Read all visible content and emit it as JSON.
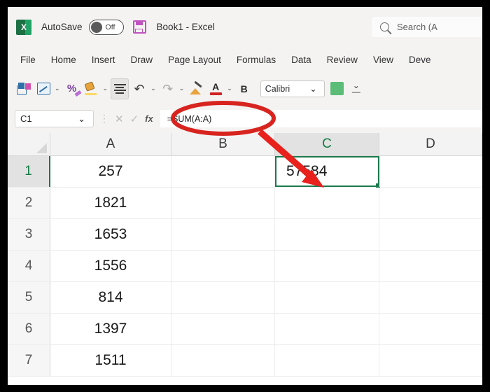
{
  "titlebar": {
    "app_icon": "excel-logo-icon",
    "autosave_label": "AutoSave",
    "autosave_state": "Off",
    "save_icon": "save-disk-icon",
    "document_title": "Book1  -  Excel",
    "search_icon": "search-icon",
    "search_placeholder": "Search (A"
  },
  "ribbon": {
    "tabs": [
      {
        "label": "File"
      },
      {
        "label": "Home"
      },
      {
        "label": "Insert"
      },
      {
        "label": "Draw"
      },
      {
        "label": "Page Layout"
      },
      {
        "label": "Formulas"
      },
      {
        "label": "Data"
      },
      {
        "label": "Review"
      },
      {
        "label": "View"
      },
      {
        "label": "Deve"
      }
    ]
  },
  "toolbar": {
    "items": [
      {
        "icon": "paste-icon"
      },
      {
        "icon": "edit-cell-icon"
      },
      {
        "icon": "percent-style-icon"
      },
      {
        "icon": "fill-color-icon"
      },
      {
        "icon": "align-text-icon"
      },
      {
        "icon": "undo-icon"
      },
      {
        "icon": "redo-icon"
      },
      {
        "icon": "format-painter-icon"
      },
      {
        "icon": "font-color-icon"
      },
      {
        "icon": "bold-icon"
      }
    ],
    "bold_label": "B",
    "font_name": "Calibri",
    "caret": "⌄",
    "fill_swatch_color": "#5bbd77",
    "overflow_glyph": "⌄"
  },
  "formula_bar": {
    "name_box_value": "C1",
    "name_box_caret": "⌄",
    "separator": "⋮",
    "cancel_icon": "cancel-x-icon",
    "cancel_glyph": "✕",
    "confirm_icon": "confirm-check-icon",
    "confirm_glyph": "✓",
    "function_label": "fx",
    "formula_value": "=SUM(A:A)"
  },
  "grid": {
    "select_all_icon": "select-all-corner-icon",
    "columns": [
      {
        "label": "A",
        "width": 173,
        "active": false
      },
      {
        "label": "B",
        "width": 148,
        "active": false
      },
      {
        "label": "C",
        "width": 149,
        "active": true
      },
      {
        "label": "D",
        "width": 147,
        "active": false
      }
    ],
    "rows": [
      {
        "header": "1",
        "active": true,
        "cells": [
          "257",
          "",
          "57584",
          ""
        ],
        "selected_col": 2
      },
      {
        "header": "2",
        "active": false,
        "cells": [
          "1821",
          "",
          "",
          ""
        ],
        "selected_col": -1
      },
      {
        "header": "3",
        "active": false,
        "cells": [
          "1653",
          "",
          "",
          ""
        ],
        "selected_col": -1
      },
      {
        "header": "4",
        "active": false,
        "cells": [
          "1556",
          "",
          "",
          ""
        ],
        "selected_col": -1
      },
      {
        "header": "5",
        "active": false,
        "cells": [
          "814",
          "",
          "",
          ""
        ],
        "selected_col": -1
      },
      {
        "header": "6",
        "active": false,
        "cells": [
          "1397",
          "",
          "",
          ""
        ],
        "selected_col": -1
      },
      {
        "header": "7",
        "active": false,
        "cells": [
          "1511",
          "",
          "",
          ""
        ],
        "selected_col": -1
      }
    ]
  },
  "annotation": {
    "highlight_color": "#d8241f",
    "ellipse_target": "formula-bar-value",
    "arrow_target": "cell-C1"
  }
}
